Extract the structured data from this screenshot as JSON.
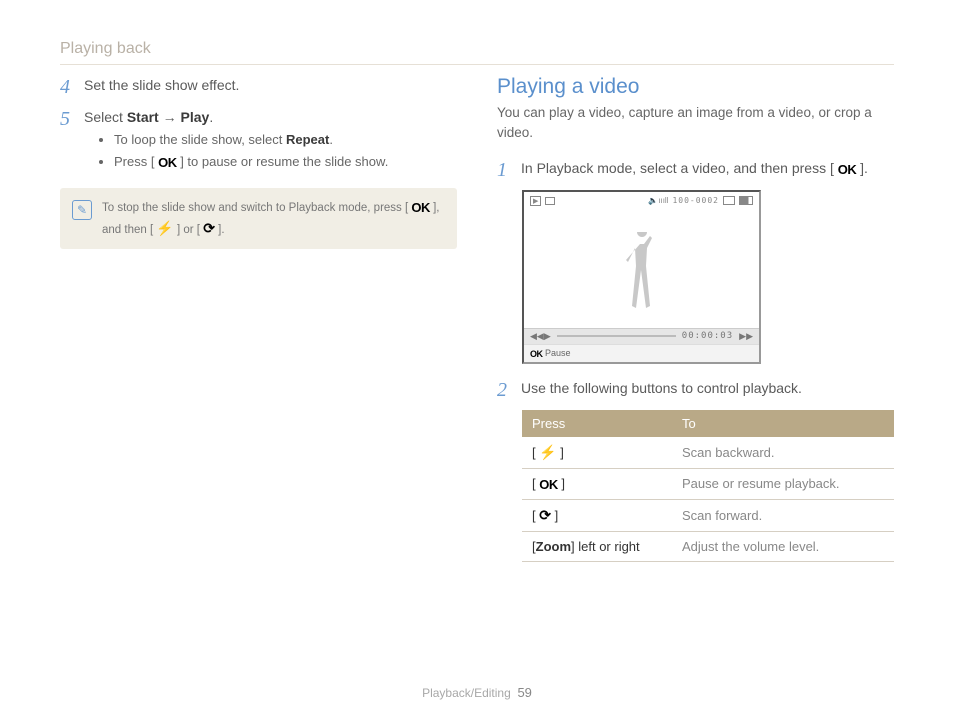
{
  "section_header": "Playing back",
  "left": {
    "step4": {
      "num": "4",
      "text": "Set the slide show effect."
    },
    "step5": {
      "num": "5",
      "text_prefix": "Select ",
      "bold1": "Start",
      "arrow": " → ",
      "bold2": "Play",
      "text_suffix": "."
    },
    "bullet1_prefix": "To loop the slide show, select ",
    "bullet1_bold": "Repeat",
    "bullet1_suffix": ".",
    "bullet2_prefix": "Press [ ",
    "bullet2_suffix": " ] to pause or resume the slide show.",
    "note_prefix": "To stop the slide show and switch to Playback mode, press [ ",
    "note_mid": " ], and then [ ",
    "note_mid2": " ] or [ ",
    "note_suffix": " ]."
  },
  "right": {
    "heading": "Playing a video",
    "desc": "You can play a video, capture an image from a video, or crop a video.",
    "step1": {
      "num": "1",
      "text_prefix": "In Playback mode, select a video, and then press [ ",
      "text_suffix": " ]."
    },
    "video": {
      "folder": "100-0002",
      "time": "00:00:03",
      "ok_label": "Pause"
    },
    "step2": {
      "num": "2",
      "text": "Use the following buttons to control playback."
    },
    "table": {
      "head_press": "Press",
      "head_to": "To",
      "rows": [
        {
          "to": "Scan backward."
        },
        {
          "to": "Pause or resume playback."
        },
        {
          "to": "Scan forward."
        },
        {
          "key_prefix": "[",
          "key_bold": "Zoom",
          "key_suffix": "] left or right",
          "to": "Adjust the volume level."
        }
      ]
    }
  },
  "footer": {
    "chapter": "Playback/Editing",
    "page": "59"
  }
}
